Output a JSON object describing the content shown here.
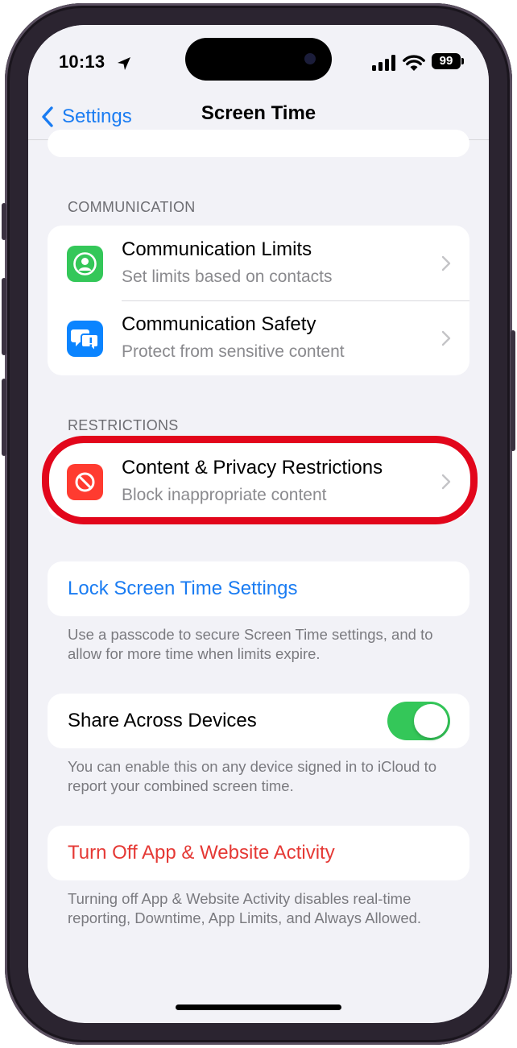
{
  "status_bar": {
    "time": "10:13",
    "battery": "99"
  },
  "nav": {
    "back_label": "Settings",
    "title": "Screen Time"
  },
  "communication": {
    "header": "COMMUNICATION",
    "items": [
      {
        "title": "Communication Limits",
        "subtitle": "Set limits based on contacts",
        "icon": "person-circle-icon",
        "color": "#34c759"
      },
      {
        "title": "Communication Safety",
        "subtitle": "Protect from sensitive content",
        "icon": "message-bubbles-icon",
        "color": "#0a84ff"
      }
    ]
  },
  "restrictions": {
    "header": "RESTRICTIONS",
    "items": [
      {
        "title": "Content & Privacy Restrictions",
        "subtitle": "Block inappropriate content",
        "icon": "no-entry-icon",
        "color": "#ff3b30"
      }
    ]
  },
  "lock": {
    "label": "Lock Screen Time Settings",
    "footer": "Use a passcode to secure Screen Time settings, and to allow for more time when limits expire."
  },
  "share": {
    "label": "Share Across Devices",
    "enabled": true,
    "footer": "You can enable this on any device signed in to iCloud to report your combined screen time."
  },
  "turn_off": {
    "label": "Turn Off App & Website Activity",
    "footer": "Turning off App & Website Activity disables real-time reporting, Downtime, App Limits, and Always Allowed."
  },
  "colors": {
    "accent": "#1a7cf2",
    "destructive": "#e53935",
    "toggle_on": "#34c759",
    "highlight": "#e2061b"
  }
}
